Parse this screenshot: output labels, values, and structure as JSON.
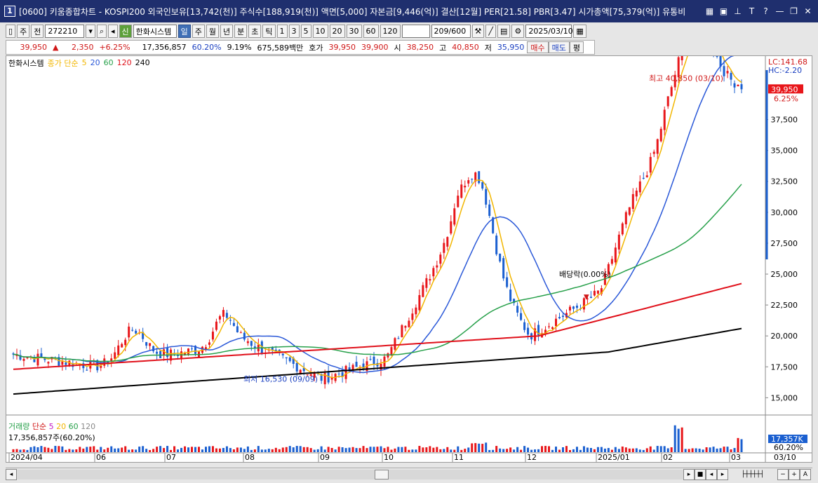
{
  "window": {
    "number": "1",
    "title": "[0600] 키움종합차트 - KOSPI200 외국인보유[13,742(천)] 주식수[188,919(천)] 액면[5,000] 자본금[9,446(억)] 결산[12월] PER[21.58] PBR[3.47] 시가총액[75,379(억)] 유통비"
  },
  "toolbar": {
    "period_label": "주",
    "prev_label": "전",
    "code": "272210",
    "company": "한화시스템",
    "badge": "신",
    "periods": [
      "일",
      "주",
      "월",
      "년",
      "분",
      "초",
      "틱"
    ],
    "minutes": [
      "1",
      "3",
      "5",
      "10",
      "20",
      "30",
      "60",
      "120"
    ],
    "count": "209/600",
    "date": "2025/03/10"
  },
  "quote": {
    "price": "39,950",
    "arrow": "▲",
    "change": "2,350",
    "pct": "+6.25%",
    "volume": "17,356,857",
    "vol_ratio": "60.20%",
    "turnover": "9.19%",
    "amount": "675,589백만",
    "hoga_label": "호가",
    "ask": "39,950",
    "bid": "39,900",
    "open_label": "시",
    "open": "38,250",
    "high_label": "고",
    "high": "40,850",
    "low_label": "저",
    "low": "35,950",
    "buy": "매수",
    "sell": "매도",
    "flat": "평"
  },
  "legend": {
    "name": "한화시스템",
    "price_ma": "종가 단순",
    "ma": [
      "5",
      "20",
      "60",
      "120",
      "240"
    ]
  },
  "annotations": {
    "high": "최고 40,850 (03/10)",
    "low": "최저 16,530 (09/09)",
    "dividend": "배당락(0.00%)"
  },
  "axis": {
    "lc": "LC:141.68",
    "hc": "HC:-2.20",
    "last_price": "39,950",
    "last_pct": "6.25%",
    "yticks": [
      "37,500",
      "35,000",
      "32,500",
      "30,000",
      "27,500",
      "25,000",
      "22,500",
      "20,000",
      "17,500",
      "15,000"
    ],
    "vol_last": "17,357K",
    "vol_pct": "60.20%",
    "xticks": [
      "2024/04",
      "06",
      "07",
      "08",
      "09",
      "10",
      "11",
      "12",
      "2025/01",
      "02",
      "03"
    ],
    "x_last": "03/10"
  },
  "volume": {
    "label": "거래량",
    "ma_label": "단순",
    "ma": [
      "5",
      "20",
      "60",
      "120"
    ],
    "value": "17,356,857주(60.20%)"
  },
  "colors": {
    "up": "#e8161a",
    "down": "#1a5fd0",
    "ma5": "#f2b600",
    "ma20": "#2a58d8",
    "ma60": "#27a04a",
    "ma120": "#e0101a",
    "ma240": "#000000"
  },
  "chart_data": {
    "type": "candlestick",
    "title": "한화시스템",
    "x_start": "2024/04",
    "x_end": "2025/03/10",
    "ylim": [
      14000,
      41500
    ],
    "close_points": [
      [
        "2024/04",
        18500
      ],
      [
        "06",
        17500
      ],
      [
        "07",
        18500
      ],
      [
        "08",
        19500
      ],
      [
        "09",
        16530
      ],
      [
        "10",
        18200
      ],
      [
        "11",
        29000
      ],
      [
        "12",
        20000
      ],
      [
        "2025/01",
        23500
      ],
      [
        "02",
        35500
      ],
      [
        "03/10",
        39950
      ]
    ],
    "last": {
      "price": 39950,
      "high": 40850,
      "low": 35950,
      "open": 38250
    }
  }
}
